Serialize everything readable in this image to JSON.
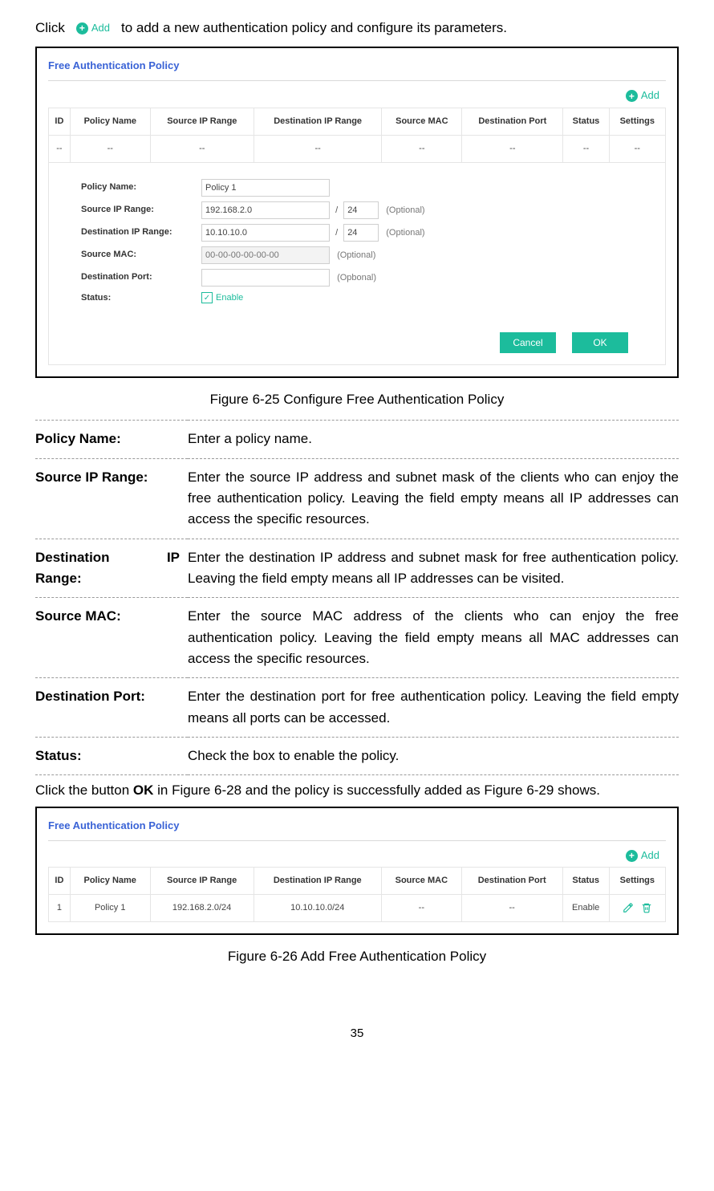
{
  "intro": {
    "prefix": "Click",
    "add_label": "Add",
    "suffix": "to add a new authentication policy and configure its parameters."
  },
  "panel1": {
    "title": "Free Authentication Policy",
    "add_label": "Add",
    "columns": [
      "ID",
      "Policy Name",
      "Source IP Range",
      "Destination IP Range",
      "Source MAC",
      "Destination Port",
      "Status",
      "Settings"
    ],
    "empty_cells": [
      "--",
      "--",
      "--",
      "--",
      "--",
      "--",
      "--",
      "--"
    ],
    "form": {
      "labels": {
        "policy_name": "Policy Name:",
        "src_ip": "Source IP Range:",
        "dst_ip": "Destination IP Range:",
        "src_mac": "Source MAC:",
        "dst_port": "Destination Port:",
        "status": "Status:"
      },
      "values": {
        "policy_name": "Policy 1",
        "src_ip": "192.168.2.0",
        "src_mask": "24",
        "dst_ip": "10.10.10.0",
        "dst_mask": "24",
        "src_mac_placeholder": "00-00-00-00-00-00",
        "dst_port": ""
      },
      "optional": "(Optional)",
      "optional_typo": "(Opbonal)",
      "enable": "Enable",
      "buttons": {
        "cancel": "Cancel",
        "ok": "OK"
      }
    }
  },
  "caption1": "Figure 6-25 Configure Free Authentication Policy",
  "definitions": [
    {
      "k": "Policy Name:",
      "v": "Enter a policy name."
    },
    {
      "k": "Source IP Range:",
      "v": "Enter the source IP address and subnet mask of the clients who can enjoy the free authentication policy. Leaving the field empty means all IP addresses can access the specific resources."
    },
    {
      "k": "Destination IP Range:",
      "k_split": [
        "Destination",
        "IP",
        "Range:"
      ],
      "v": "Enter the destination IP address and subnet mask for free authentication policy. Leaving the field empty means all IP addresses can be visited."
    },
    {
      "k": "Source MAC:",
      "v": "Enter the source MAC address of the clients who can enjoy the free authentication policy. Leaving the field empty means all MAC addresses can access the specific resources."
    },
    {
      "k": "Destination Port:",
      "v": "Enter the destination port for free authentication policy. Leaving the field empty means all ports can be accessed."
    },
    {
      "k": "Status:",
      "v": "Check the box to enable the policy."
    }
  ],
  "midtext": {
    "a": "Click the button ",
    "b": "OK",
    "c": " in Figure 6-28 and the policy is successfully added as Figure 6-29 shows."
  },
  "panel2": {
    "title": "Free Authentication Policy",
    "add_label": "Add",
    "columns": [
      "ID",
      "Policy Name",
      "Source IP Range",
      "Destination IP Range",
      "Source MAC",
      "Destination Port",
      "Status",
      "Settings"
    ],
    "row": {
      "id": "1",
      "name": "Policy 1",
      "src": "192.168.2.0/24",
      "dst": "10.10.10.0/24",
      "mac": "--",
      "port": "--",
      "status": "Enable"
    }
  },
  "caption2": "Figure 6-26 Add Free Authentication Policy",
  "pageno": "35"
}
